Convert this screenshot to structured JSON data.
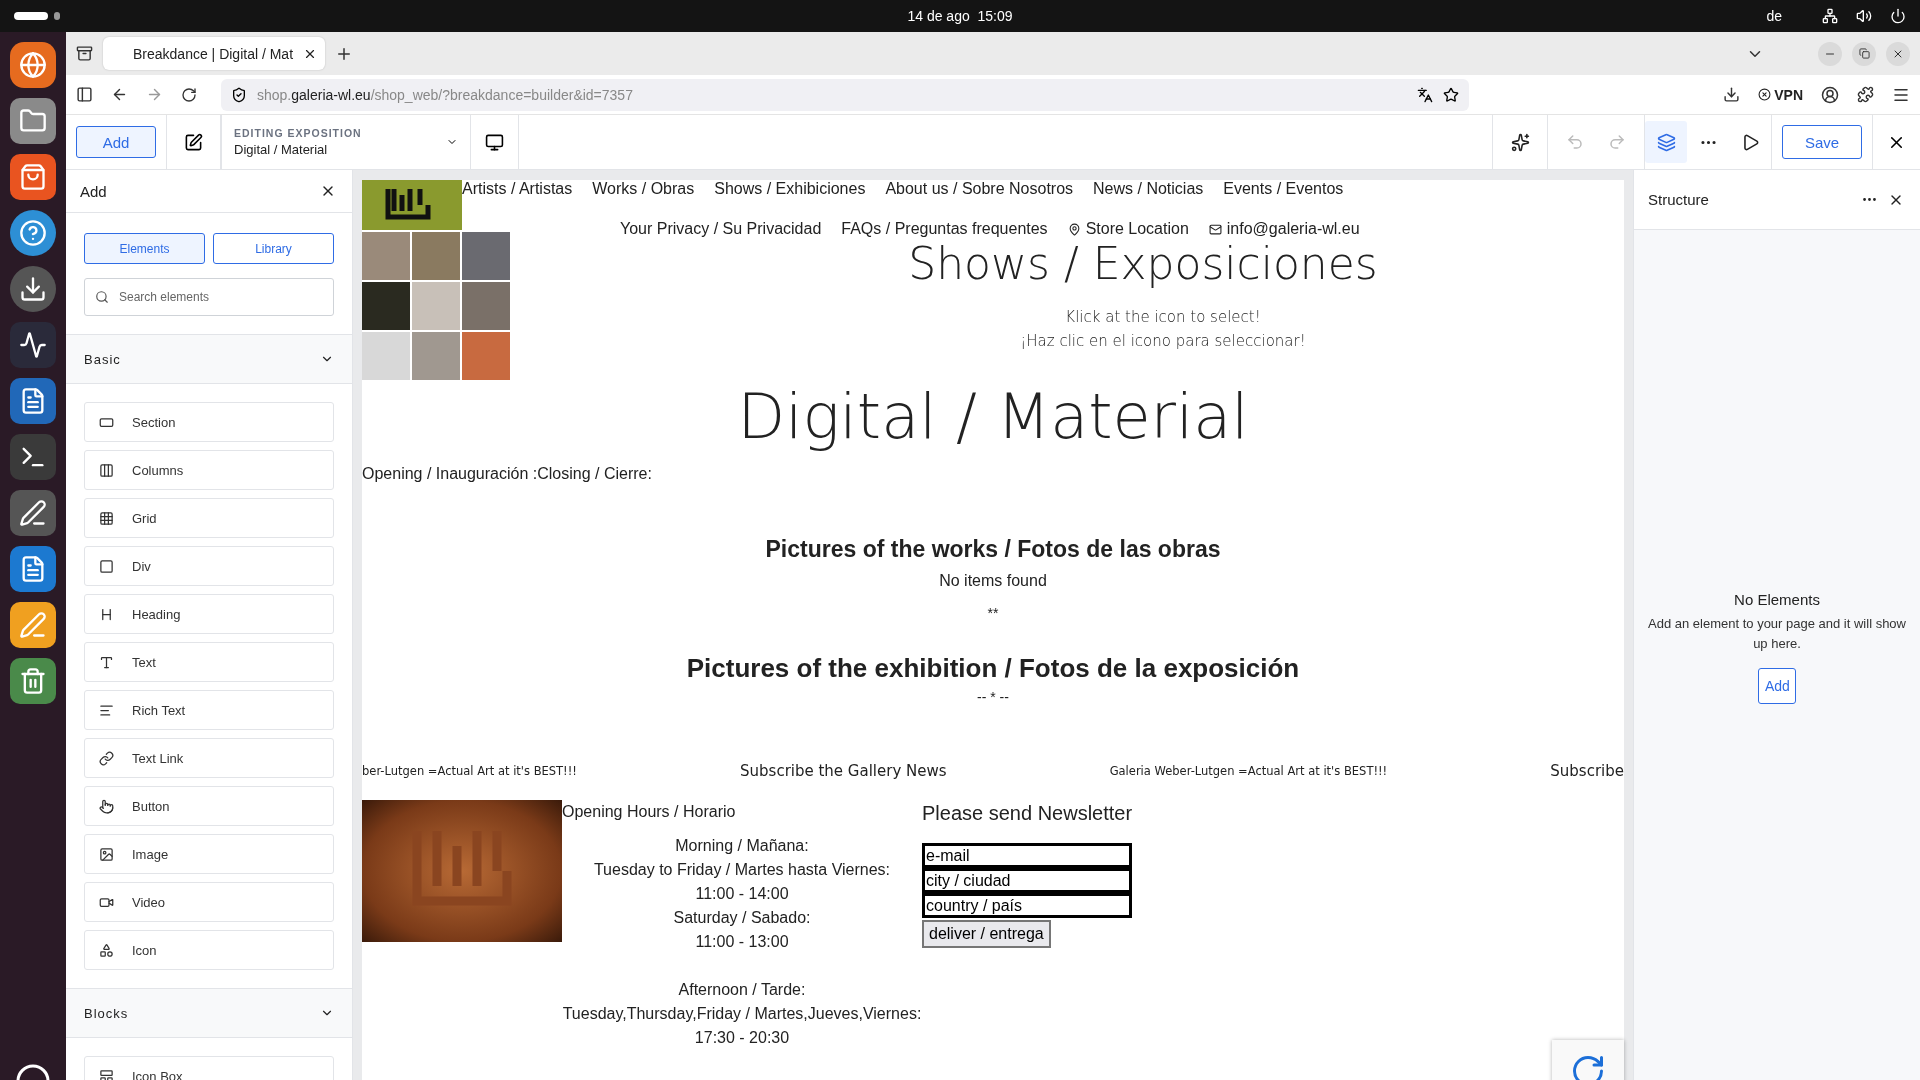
{
  "system_bar": {
    "date": "14 de ago",
    "time": "15:09",
    "language": "de"
  },
  "browser": {
    "tab_title": "Breakdance | Digital / Mat",
    "url_prefix": "shop.",
    "url_domain": "galeria-wl.eu",
    "url_path": "/shop_web/?breakdance=builder&id=7357",
    "vpn_label": "VPN"
  },
  "builder_toolbar": {
    "add_label": "Add",
    "editing_caption": "EDITING EXPOSITION",
    "editing_value": "Digital / Material",
    "save_label": "Save"
  },
  "add_panel": {
    "title": "Add",
    "tabs": [
      {
        "label": "Elements",
        "selected": true
      },
      {
        "label": "Library",
        "selected": false
      }
    ],
    "search": {
      "placeholder": "Search elements"
    },
    "sections": [
      {
        "title": "Basic",
        "expanded": true,
        "items": [
          "Section",
          "Columns",
          "Grid",
          "Div",
          "Heading",
          "Text",
          "Rich Text",
          "Text Link",
          "Button",
          "Image",
          "Video",
          "Icon"
        ]
      },
      {
        "title": "Blocks",
        "expanded": true,
        "items": [
          "Icon Box"
        ]
      }
    ]
  },
  "page": {
    "nav_links": [
      "Artists / Artistas",
      "Works / Obras",
      "Shows / Exhibiciones",
      "About us / Sobre Nosotros",
      "News / Noticias",
      "Events / Eventos"
    ],
    "secondary_links": [
      {
        "label": "Your Privacy / Su Privacidad",
        "kind": "text"
      },
      {
        "label": "FAQs / Preguntas frequentes",
        "kind": "text"
      },
      {
        "label": "Store Location",
        "kind": "location"
      },
      {
        "label": "info@galeria-wl.eu",
        "kind": "email"
      }
    ],
    "heading": "Shows / Exposiciones",
    "hint_lines": [
      "Klick at the icon to select!",
      "¡Haz clic en el icono para seleccionar!"
    ],
    "title": "Digital / Material",
    "dates": "Opening / Inauguración :Closing / Cierre:",
    "works_heading": "Pictures of the works / Fotos de las obras",
    "works_empty": "No items found",
    "works_separator": "**",
    "exhibition_heading": "Pictures of the exhibition / Fotos de la exposición",
    "exhibition_separator": "-- * --",
    "ticker": [
      "ber-Lutgen  =Actual Art at it's BEST!!!",
      "Subscribe the Gallery News",
      "Galeria Weber-Lutgen  =Actual Art at it's BEST!!!",
      "Subscribe"
    ],
    "hours": {
      "title": "Opening Hours / Horario",
      "groups": [
        [
          "Morning / Mañana:",
          "Tuesday to Friday / Martes hasta Viernes:",
          "11:00 - 14:00",
          "Saturday / Sabado:",
          "11:00 - 13:00"
        ],
        [
          "Afternoon / Tarde:",
          "Tuesday,Thursday,Friday / Martes,Jueves,Viernes:",
          "17:30 - 20:30"
        ]
      ]
    },
    "newsletter": {
      "title": "Please send Newsletter",
      "fields": [
        {
          "value": "e-mail"
        },
        {
          "value": "city / ciudad"
        },
        {
          "value": "country / país"
        }
      ],
      "button": "deliver / entrega"
    }
  },
  "structure_panel": {
    "title": "Structure",
    "empty_title": "No Elements",
    "empty_text": "Add an element to your page and it will show up here.",
    "add_label": "Add"
  }
}
